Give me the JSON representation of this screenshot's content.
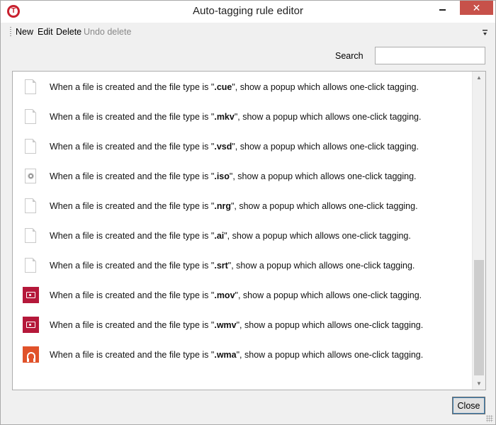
{
  "window": {
    "title": "Auto-tagging rule editor",
    "minimize_glyph": "",
    "close_glyph": "✕"
  },
  "menu": {
    "new": "New",
    "edit": "Edit",
    "delete": "Delete",
    "undo_delete": "Undo delete"
  },
  "search": {
    "label": "Search",
    "value": "",
    "placeholder": ""
  },
  "rules": [
    {
      "icon": "blank-file-icon",
      "prefix": "When a file is created  and the file type is \"",
      "ext": ".cue",
      "suffix": "\", show a popup which allows one-click tagging."
    },
    {
      "icon": "blank-file-icon",
      "prefix": "When a file is created  and the file type is \"",
      "ext": ".mkv",
      "suffix": "\", show a popup which allows one-click tagging."
    },
    {
      "icon": "blank-file-icon",
      "prefix": "When a file is created  and the file type is \"",
      "ext": ".vsd",
      "suffix": "\", show a popup which allows one-click tagging."
    },
    {
      "icon": "disc-image-icon",
      "prefix": "When a file is created  and the file type is \"",
      "ext": ".iso",
      "suffix": "\", show a popup which allows one-click tagging."
    },
    {
      "icon": "blank-file-icon",
      "prefix": "When a file is created  and the file type is \"",
      "ext": ".nrg",
      "suffix": "\", show a popup which allows one-click tagging."
    },
    {
      "icon": "blank-file-icon",
      "prefix": "When a file is created  and the file type is \"",
      "ext": ".ai",
      "suffix": "\", show a popup which allows one-click tagging."
    },
    {
      "icon": "blank-file-icon",
      "prefix": "When a file is created  and the file type is \"",
      "ext": ".srt",
      "suffix": "\", show a popup which allows one-click tagging."
    },
    {
      "icon": "video-file-icon",
      "prefix": "When a file is created  and the file type is \"",
      "ext": ".mov",
      "suffix": "\", show a popup which allows one-click tagging."
    },
    {
      "icon": "video-file-icon",
      "prefix": "When a file is created  and the file type is \"",
      "ext": ".wmv",
      "suffix": "\", show a popup which allows one-click tagging."
    },
    {
      "icon": "audio-file-icon",
      "prefix": "When a file is created  and the file type is \"",
      "ext": ".wma",
      "suffix": "\", show a popup which allows one-click tagging."
    }
  ],
  "footer": {
    "close_label": "Close"
  },
  "colors": {
    "video_icon": "#b5183a",
    "audio_icon": "#e0522a",
    "close_button_bg": "#c7514a"
  }
}
